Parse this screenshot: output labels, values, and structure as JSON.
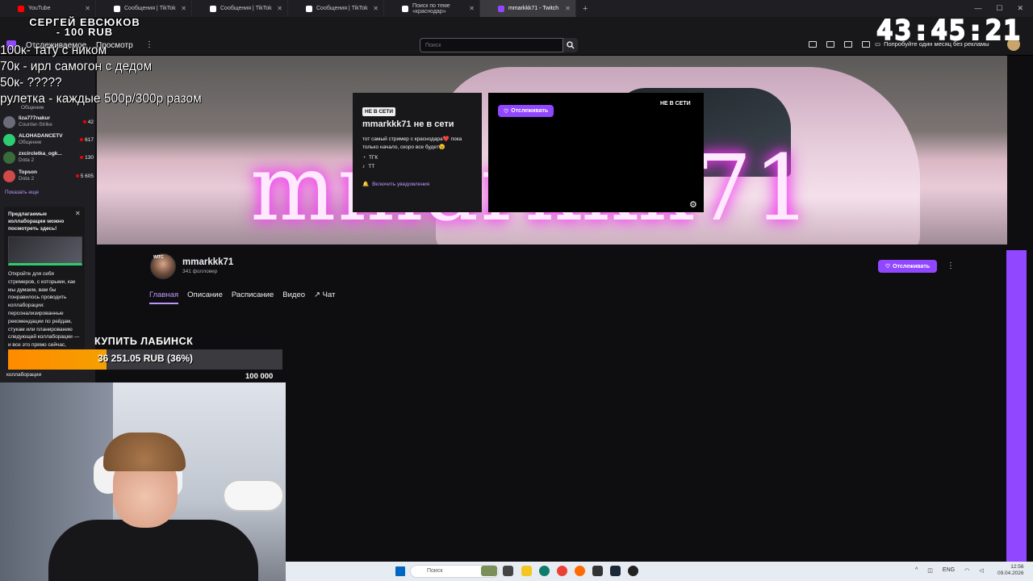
{
  "browser": {
    "tabs": [
      {
        "label": "YouTube",
        "color": "#ff0000"
      },
      {
        "label": "Сообщения | TikTok",
        "color": "#ffffff"
      },
      {
        "label": "Сообщения | TikTok",
        "color": "#ffffff"
      },
      {
        "label": "Сообщения | TikTok",
        "color": "#ffffff"
      },
      {
        "label": "Поиск по теме «краснодар»",
        "color": "#ffffff"
      },
      {
        "label": "mmarkkk71 - Twitch",
        "color": "#9147ff"
      }
    ],
    "new_tab_glyph": "+"
  },
  "overlay": {
    "donor_name": "СЕРГЕЙ ЕВСЮКОВ",
    "donor_amount": "- 100 RUB",
    "clock": "43:45:21",
    "goals": [
      "100к- тату с ником",
      "70к - ирл самогон с дедом",
      "50к- ?????",
      "рулетка - каждые 500р/300р разом"
    ]
  },
  "twitch_nav": {
    "following": "Отслеживаемое",
    "browse": "Просмотр",
    "search_placeholder": "Поиск",
    "promo": "Попробуйте один месяц без рекламы"
  },
  "sidebar": {
    "channels": [
      {
        "name": "liza777nakur",
        "game": "Counter-Strike",
        "viewers": "42",
        "color": "#6b6b7a"
      },
      {
        "name": "ALOHADANCETV",
        "game": "Общение",
        "viewers": "617",
        "color": "#2ecc71"
      },
      {
        "name": "zxcircletka_ogk...",
        "game": "Dota 2",
        "viewers": "130",
        "color": "#3a6b3a"
      },
      {
        "name": "Topson",
        "game": "Dota 2",
        "viewers": "5 605",
        "color": "#d14a4a"
      }
    ],
    "first_channel_game": "Общение",
    "show_more": "Показать еще",
    "collab": {
      "title": "Предлагаемые коллаборации можно посмотреть здесь!",
      "text": "Откройте для себя стримеров, с которыми, как мы думаем, вам бы понравилось проводить коллаборации: персонализированные рекомендации по рейдам, стукам или планированию следующей коллаборации — и все это прямо сейчас,",
      "footer": "коллаборации"
    }
  },
  "offline": {
    "badge": "НЕ В СЕТИ",
    "title": "mmarkkk71 не в сети",
    "description": "тот самый стример с краснодара❤️ пока только начало, скоро все будет😉",
    "socials": [
      "ТГК",
      "ТТ"
    ],
    "notify": "Включить уведомления",
    "player_follow": "Отслеживать",
    "player_status": "НЕ В СЕТИ"
  },
  "banner": {
    "text": "mmarkkk71"
  },
  "channel": {
    "avatar_tag": "WITC",
    "name": "mmarkkk71",
    "followers": "341 фолловер",
    "follow": "Отслеживать",
    "tabs": [
      "Главная",
      "Описание",
      "Расписание",
      "Видео",
      "Чат"
    ],
    "active_tab": 0
  },
  "donation_goal": {
    "title": "КУПИТЬ ЛАБИНСК",
    "amount_text": "36 251.05 RUB (36%)",
    "target": "100 000",
    "progress": 0.36
  },
  "taskbar": {
    "search": "Поиск",
    "lang": "ENG",
    "time": "12:56",
    "date": "09.04.2026"
  },
  "colors": {
    "accent": "#9147ff",
    "live": "#eb0400",
    "goal": "#ff8a00"
  }
}
